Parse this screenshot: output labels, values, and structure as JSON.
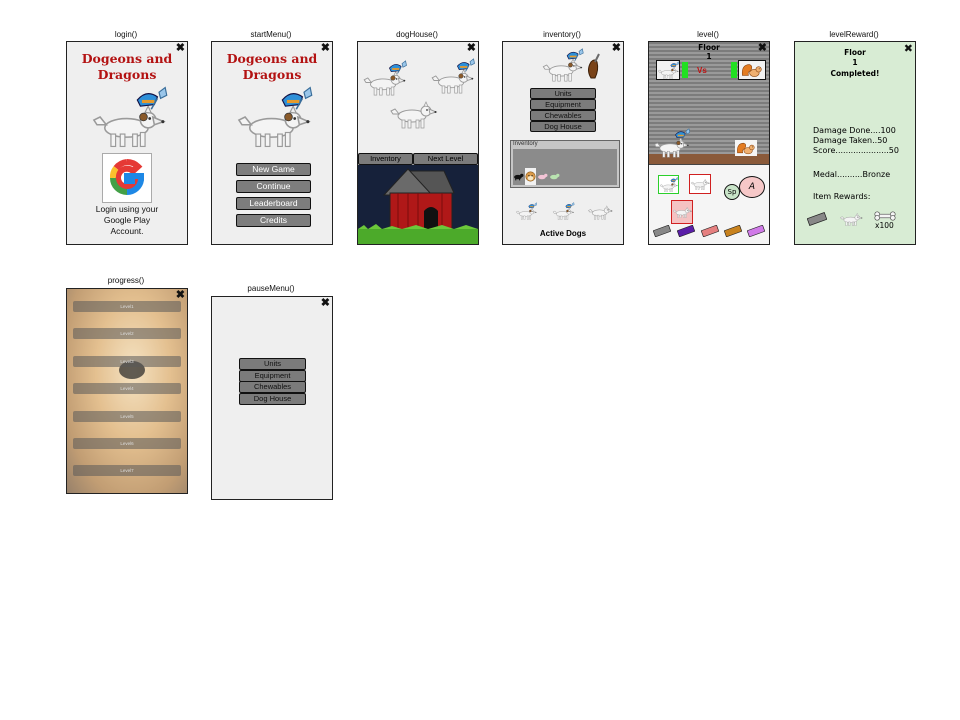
{
  "screens": {
    "login": {
      "caption": "login()",
      "title_l1": "Dogeons and",
      "title_l2": "Dragons",
      "google_letter": "G",
      "login_l1": "Login using your",
      "login_l2": "Google Play",
      "login_l3": "Account."
    },
    "startMenu": {
      "caption": "startMenu()",
      "title_l1": "Dogeons and",
      "title_l2": "Dragons",
      "buttons": [
        "New Game",
        "Continue",
        "Leaderboard",
        "Credits"
      ]
    },
    "dogHouse": {
      "caption": "dogHouse()",
      "tabs": [
        "Inventory",
        "Next Level"
      ]
    },
    "inventory": {
      "caption": "inventory()",
      "buttons": [
        "Units",
        "Equipment",
        "Chewables",
        "Dog House"
      ],
      "grid_label": "Inventory",
      "active_label": "Active Dogs"
    },
    "level": {
      "caption": "level()",
      "floor_label": "Floor",
      "floor_num": "1",
      "vs": "Vs",
      "sp_label": "Sp",
      "a_label": "A"
    },
    "levelReward": {
      "caption": "levelReward()",
      "floor_label": "Floor",
      "floor_num": "1",
      "completed": "Completed!",
      "stats": [
        "Damage Done....100",
        "Damage Taken..50",
        "Score.....................50"
      ],
      "medal": "Medal..........Bronze",
      "rewards_label": "Item Rewards:",
      "bone_count": "x100"
    },
    "progress": {
      "caption": "progress()",
      "levels": [
        "Level1",
        "Level2",
        "Level3",
        "Level4",
        "Level5",
        "Level6",
        "Level7"
      ]
    },
    "pauseMenu": {
      "caption": "pauseMenu()",
      "buttons": [
        "Units",
        "Equipment",
        "Chewables",
        "Dog House"
      ]
    }
  },
  "close_glyph": "✖",
  "colors": {
    "title_red": "#b31212",
    "button_gray": "#7d7d7d",
    "reward_bg": "#d8ecd4",
    "house_red": "#b01818",
    "grass": "#4caa2a",
    "sky_dark": "#16213a"
  },
  "icons": [
    "close-icon",
    "google-logo-icon",
    "dog-icon",
    "doghouse-icon",
    "squirrel-icon",
    "bone-icon",
    "chew-toy-icon"
  ]
}
